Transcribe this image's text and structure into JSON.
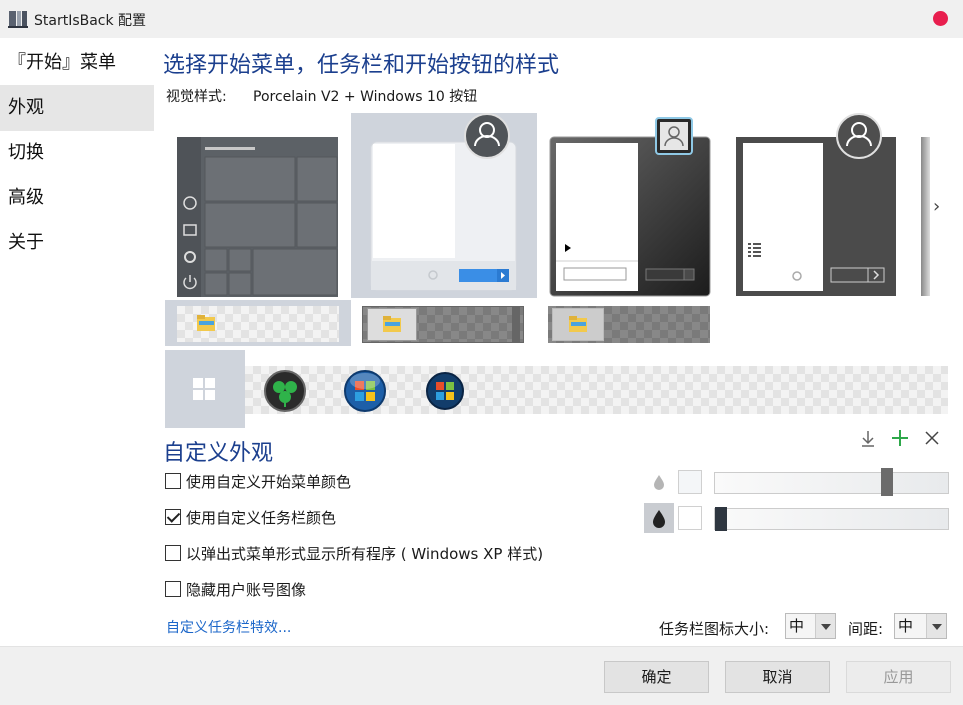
{
  "window": {
    "title": "StartIsBack 配置"
  },
  "sidebar": {
    "items": [
      {
        "label": "『开始』菜单"
      },
      {
        "label": "外观"
      },
      {
        "label": "切换"
      },
      {
        "label": "高级"
      },
      {
        "label": "关于"
      }
    ]
  },
  "main": {
    "title": "选择开始菜单，任务栏和开始按钮的样式",
    "visual_style_label": "视觉样式:",
    "visual_style_value": "Porcelain V2 + Windows 10 按钮"
  },
  "custom": {
    "title": "自定义外观",
    "options": [
      {
        "label": "使用自定义开始菜单颜色",
        "checked": false
      },
      {
        "label": "使用自定义任务栏颜色",
        "checked": true
      },
      {
        "label": "以弹出式菜单形式显示所有程序 ( Windows XP 样式)",
        "checked": false
      },
      {
        "label": "隐藏用户账号图像",
        "checked": false
      }
    ],
    "link": "自定义任务栏特效...",
    "start_menu_opacity": 0.75,
    "taskbar_opacity": 0.0,
    "icon_size_label": "任务栏图标大小:",
    "icon_size_value": "中",
    "spacing_label": "间距:",
    "spacing_value": "中"
  },
  "footer": {
    "ok": "确定",
    "cancel": "取消",
    "apply": "应用"
  },
  "colors": {
    "accent": "#1b3f8e",
    "link": "#1b66c9",
    "close": "#e81e4e",
    "selected": "#cfd4dc"
  }
}
